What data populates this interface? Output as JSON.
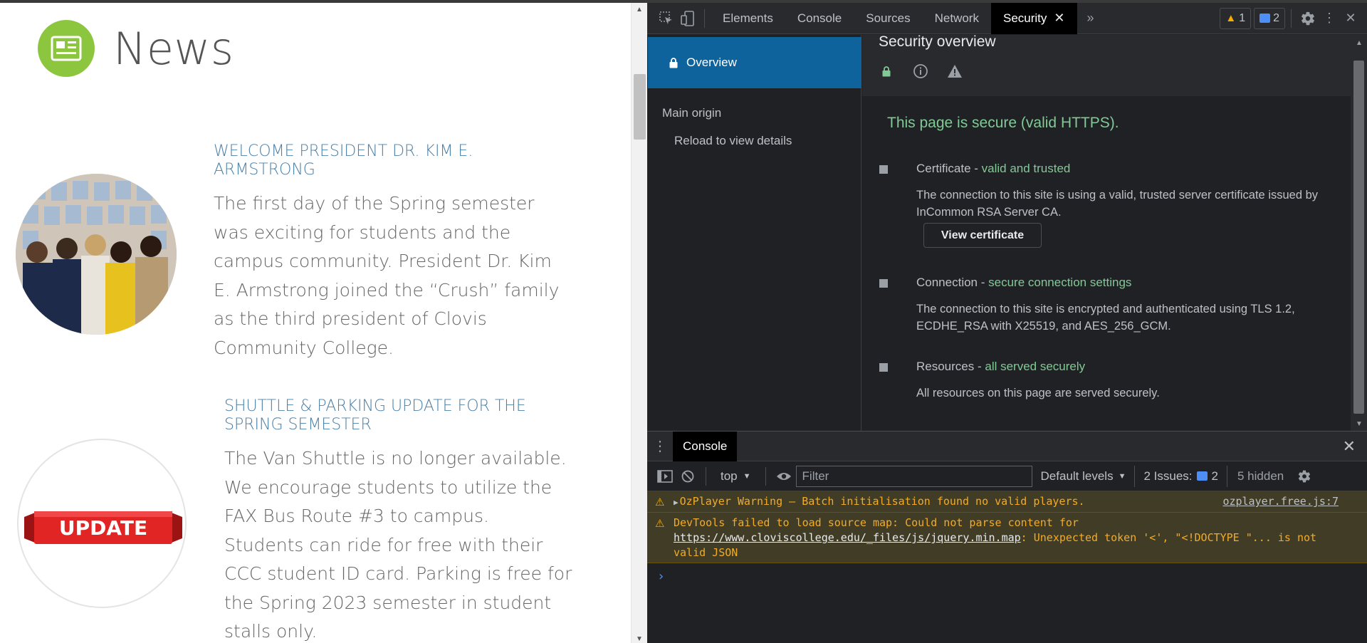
{
  "page": {
    "section_title": "News",
    "articles": [
      {
        "heading": "WELCOME PRESIDENT DR. KIM E. ARMSTRONG",
        "body": "The first day of the Spring semester was exciting for students and the campus community. President Dr. Kim E. Armstrong joined the “Crush” family as the third president of Clovis Community College."
      },
      {
        "heading": "SHUTTLE & PARKING UPDATE FOR THE SPRING SEMESTER",
        "body": "The Van Shuttle is no longer available. We encourage students to utilize the FAX Bus Route #3 to campus. Students can ride for free with their CCC student ID card. Parking is free for the Spring 2023 semester in student stalls only.",
        "badge": "UPDATE"
      }
    ]
  },
  "devtools": {
    "tabs": [
      "Elements",
      "Console",
      "Sources",
      "Network",
      "Security"
    ],
    "active_tab": "Security",
    "more_tabs": "»",
    "warning_count": "1",
    "message_count": "2",
    "sidebar": {
      "overview": "Overview",
      "main_origin": "Main origin",
      "reload": "Reload to view details"
    },
    "security": {
      "title": "Security overview",
      "summary": "This page is secure (valid HTTPS).",
      "certificate": {
        "label": "Certificate - ",
        "status": "valid and trusted",
        "desc": "The connection to this site is using a valid, trusted server certificate issued by InCommon RSA Server CA.",
        "button": "View certificate"
      },
      "connection": {
        "label": "Connection - ",
        "status": "secure connection settings",
        "desc": "The connection to this site is encrypted and authenticated using TLS 1.2, ECDHE_RSA with X25519, and AES_256_GCM."
      },
      "resources": {
        "label": "Resources - ",
        "status": "all served securely",
        "desc": "All resources on this page are served securely."
      }
    },
    "drawer": {
      "tab": "Console",
      "context": "top",
      "filter_placeholder": "Filter",
      "levels": "Default levels",
      "issues_label": "2 Issues:",
      "issues_count": "2",
      "hidden": "5 hidden",
      "logs": [
        {
          "text": "OzPlayer Warning – Batch initialisation found no valid players.",
          "source": "ozplayer.free.js:7"
        },
        {
          "prefix": "DevTools failed to load source map: Could not parse content for ",
          "url": "https://www.cloviscollege.edu/_files/js/jquery.min.map",
          "suffix": ": Unexpected token '<', \"<!DOCTYPE \"... is not valid JSON"
        }
      ],
      "prompt": "›"
    },
    "colors": {
      "secure_green": "#81c995",
      "selected_blue": "#0e639c",
      "warning_bg": "#413c26",
      "warning_text": "#f2ab26"
    }
  }
}
